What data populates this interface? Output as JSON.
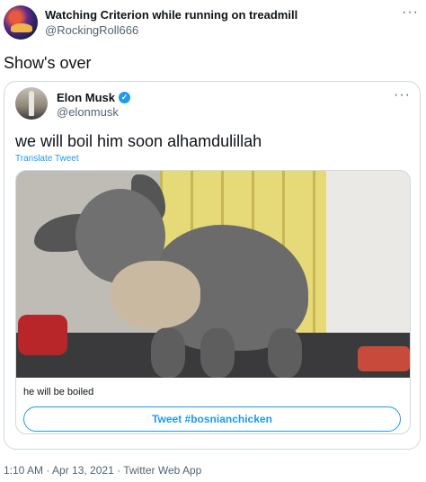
{
  "tweet": {
    "display_name": "Watching Criterion while running on treadmill",
    "handle": "@RockingRoll666",
    "text": "Show's over",
    "timestamp": "1:10 AM · Apr 13, 2021 · Twitter Web App"
  },
  "quoted": {
    "display_name": "Elon Musk",
    "verified": true,
    "handle": "@elonmusk",
    "text": "we will boil him soon alhamdulillah",
    "translate_label": "Translate Tweet"
  },
  "card": {
    "caption": "he will be boiled",
    "button_label": "Tweet #bosnianchicken"
  },
  "icons": {
    "more": "more-icon",
    "verified": "verified-icon"
  },
  "colors": {
    "accent": "#1d9bf0",
    "secondary_text": "#536471",
    "border": "#cfd9de"
  }
}
